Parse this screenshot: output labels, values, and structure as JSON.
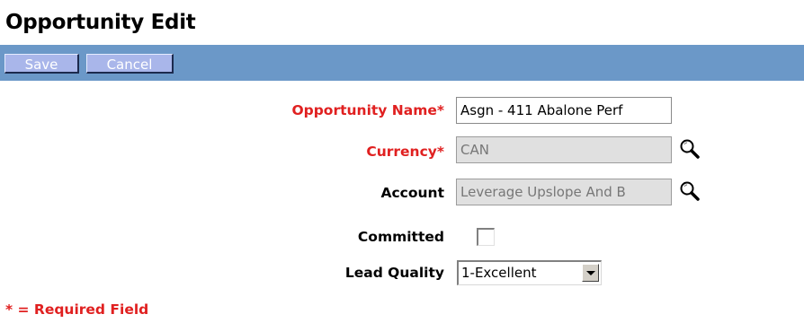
{
  "page": {
    "title": "Opportunity Edit"
  },
  "toolbar": {
    "save_label": "Save",
    "cancel_label": "Cancel"
  },
  "form": {
    "opportunity_name": {
      "label": "Opportunity Name*",
      "value": "Asgn - 411 Abalone Perf",
      "required": true
    },
    "currency": {
      "label": "Currency*",
      "value": "CAN",
      "required": true,
      "lookup_icon": "magnifier-icon"
    },
    "account": {
      "label": "Account",
      "value": "Leverage Upslope And B",
      "required": false,
      "lookup_icon": "magnifier-icon"
    },
    "committed": {
      "label": "Committed",
      "checked": false
    },
    "lead_quality": {
      "label": "Lead Quality",
      "value": "1-Excellent"
    }
  },
  "footnote": "* = Required Field",
  "colors": {
    "toolbar": "#6b98c8",
    "button": "#a9b6ea",
    "required": "#e02020"
  }
}
